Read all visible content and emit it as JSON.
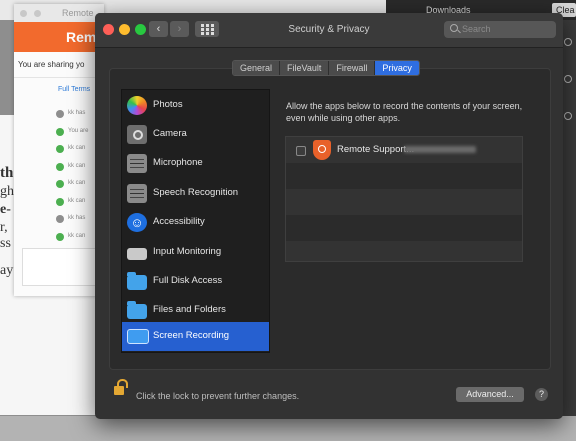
{
  "background": {
    "downloads_title": "Downloads",
    "clear_label": "Clea",
    "left_text_fragments": [
      "th",
      "gh",
      "e-",
      "r,",
      "ss",
      "ay"
    ]
  },
  "remote_window": {
    "title": "Remote",
    "header": "Rem",
    "sharing_text": "You are sharing yo",
    "full_terms": "Full Terms",
    "items": [
      {
        "status": "info",
        "text": "kk has"
      },
      {
        "status": "ok",
        "text": "You are"
      },
      {
        "status": "ok",
        "text": "kk can"
      },
      {
        "status": "ok",
        "text": "kk can"
      },
      {
        "status": "ok",
        "text": "kk can"
      },
      {
        "status": "ok",
        "text": "kk can"
      },
      {
        "status": "info",
        "text": "kk has"
      },
      {
        "status": "ok",
        "text": "kk can"
      }
    ]
  },
  "window": {
    "title": "Security & Privacy",
    "search_placeholder": "Search",
    "nav_back": "‹",
    "nav_forward": "›",
    "tabs": [
      {
        "label": "General",
        "active": false
      },
      {
        "label": "FileVault",
        "active": false
      },
      {
        "label": "Firewall",
        "active": false
      },
      {
        "label": "Privacy",
        "active": true
      }
    ],
    "sidebar": [
      {
        "label": "Photos",
        "icon": "photos-icon"
      },
      {
        "label": "Camera",
        "icon": "camera-icon"
      },
      {
        "label": "Microphone",
        "icon": "microphone-icon"
      },
      {
        "label": "Speech Recognition",
        "icon": "speech-recognition-icon"
      },
      {
        "label": "Accessibility",
        "icon": "accessibility-icon"
      },
      {
        "label": "Input Monitoring",
        "icon": "keyboard-icon"
      },
      {
        "label": "Full Disk Access",
        "icon": "folder-icon"
      },
      {
        "label": "Files and Folders",
        "icon": "folder-icon"
      },
      {
        "label": "Screen Recording",
        "icon": "display-icon",
        "selected": true
      }
    ],
    "description": "Allow the apps below to record the contents of your screen, even while using other apps.",
    "apps": [
      {
        "name": "Remote Support...",
        "checked": false,
        "icon": "remote-support-icon"
      }
    ],
    "lock_text": "Click the lock to prevent further changes.",
    "advanced_label": "Advanced...",
    "help_label": "?"
  },
  "colors": {
    "accent": "#2660d0",
    "window_bg": "#323232",
    "remote_brand": "#f26a2d",
    "lock": "#e4a833"
  }
}
